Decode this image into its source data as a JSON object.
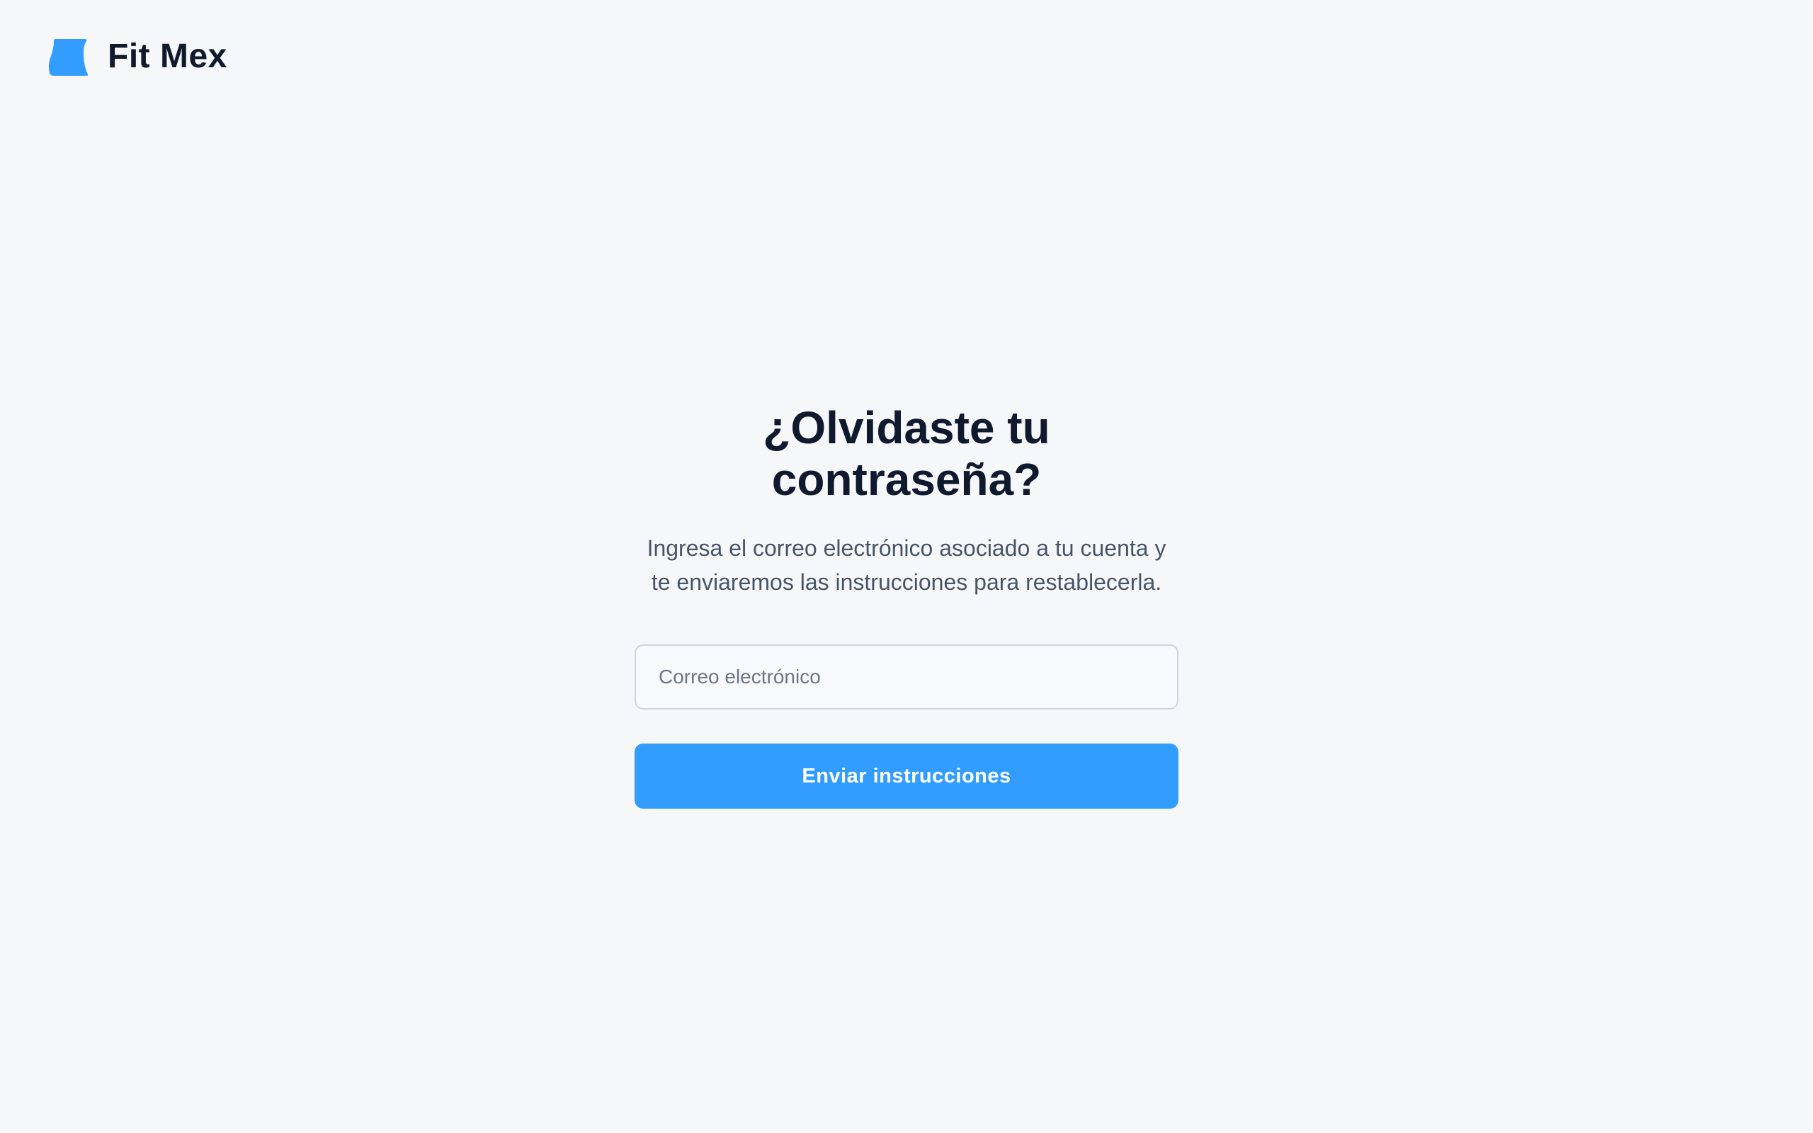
{
  "brand": {
    "name": "Fit Mex",
    "logo_icon": "brand-logo-icon",
    "logo_color": "#339dff"
  },
  "page": {
    "title": "¿Olvidaste tu contraseña?",
    "description": "Ingresa el correo electrónico asociado a tu cuenta y te enviaremos las instrucciones para restablecerla."
  },
  "form": {
    "email": {
      "placeholder": "Correo electrónico",
      "value": ""
    },
    "submit_label": "Enviar instrucciones",
    "accent_color": "#339dff"
  },
  "colors": {
    "background": "#f6f7f9",
    "heading": "#0f1a2e",
    "body_text": "#475569"
  }
}
